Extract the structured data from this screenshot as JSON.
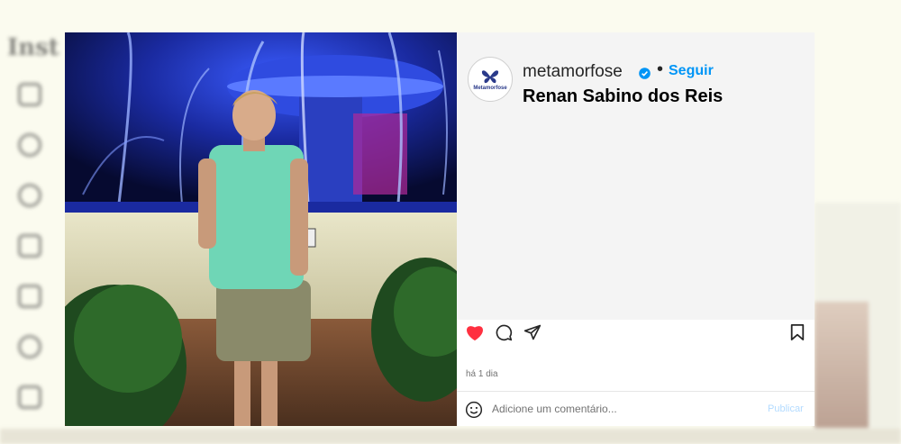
{
  "background": {
    "title": "Inst"
  },
  "post": {
    "username": "metamorfose",
    "verified_icon": "verified-badge-icon",
    "separator": "•",
    "follow_label": "Seguir",
    "caption": "Renan Sabino dos Reis",
    "avatar_text": "Metamorfose",
    "time_ago": "há 1 dia",
    "liked": true
  },
  "actions": [
    "heart-icon",
    "comment-icon",
    "share-icon",
    "bookmark-icon"
  ],
  "comment": {
    "placeholder": "Adicione um comentário...",
    "publish_label": "Publicar"
  },
  "colors": {
    "like": "#ff3040",
    "link": "#0095f6",
    "publish_disabled": "#b3dbff"
  }
}
